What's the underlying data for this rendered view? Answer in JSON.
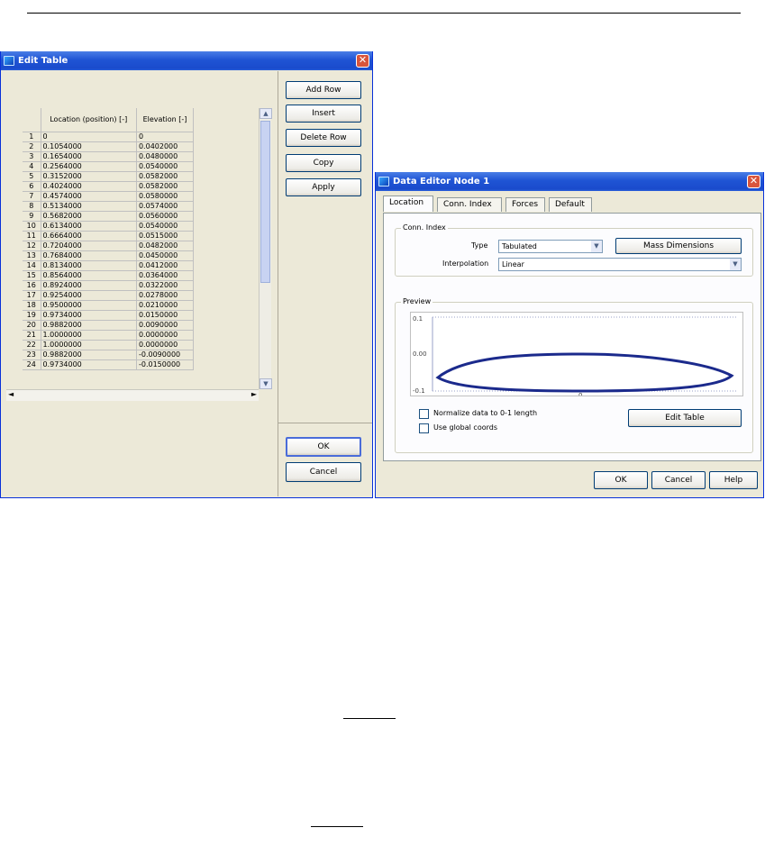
{
  "edit_table": {
    "title": "Edit Table",
    "buttons": {
      "add_row": "Add Row",
      "insert": "Insert",
      "delete_row": "Delete Row",
      "copy": "Copy",
      "apply": "Apply",
      "ok": "OK",
      "cancel": "Cancel"
    },
    "columns": [
      "Location (position) [-]",
      "Elevation [-]"
    ],
    "rows": [
      [
        "1",
        "0",
        "0"
      ],
      [
        "2",
        "0.1054000",
        "0.0402000"
      ],
      [
        "3",
        "0.1654000",
        "0.0480000"
      ],
      [
        "4",
        "0.2564000",
        "0.0540000"
      ],
      [
        "5",
        "0.3152000",
        "0.0582000"
      ],
      [
        "6",
        "0.4024000",
        "0.0582000"
      ],
      [
        "7",
        "0.4574000",
        "0.0580000"
      ],
      [
        "8",
        "0.5134000",
        "0.0574000"
      ],
      [
        "9",
        "0.5682000",
        "0.0560000"
      ],
      [
        "10",
        "0.6134000",
        "0.0540000"
      ],
      [
        "11",
        "0.6664000",
        "0.0515000"
      ],
      [
        "12",
        "0.7204000",
        "0.0482000"
      ],
      [
        "13",
        "0.7684000",
        "0.0450000"
      ],
      [
        "14",
        "0.8134000",
        "0.0412000"
      ],
      [
        "15",
        "0.8564000",
        "0.0364000"
      ],
      [
        "16",
        "0.8924000",
        "0.0322000"
      ],
      [
        "17",
        "0.9254000",
        "0.0278000"
      ],
      [
        "18",
        "0.9500000",
        "0.0210000"
      ],
      [
        "19",
        "0.9734000",
        "0.0150000"
      ],
      [
        "20",
        "0.9882000",
        "0.0090000"
      ],
      [
        "21",
        "1.0000000",
        "0.0000000"
      ],
      [
        "22",
        "1.0000000",
        "0.0000000"
      ],
      [
        "23",
        "0.9882000",
        "-0.0090000"
      ],
      [
        "24",
        "0.9734000",
        "-0.0150000"
      ]
    ]
  },
  "data_editor": {
    "title": "Data Editor Node 1",
    "tabs": [
      "Location",
      "Conn. Index",
      "Forces",
      "Default"
    ],
    "group_conn": "Conn. Index",
    "type_label": "Type",
    "type_value": "Tabulated",
    "mass_button": "Mass Dimensions",
    "interp_label": "Interpolation",
    "interp_value": "Linear",
    "group_preview": "Preview",
    "plot_ticks": {
      "y_top": "0.1",
      "y_mid": "0.00",
      "y_bottom": "-0.1",
      "x_mid": "0"
    },
    "edit_table_button": "Edit Table",
    "checkbox_1": "Normalize data to 0-1 length",
    "checkbox_2": "Use global coords",
    "buttons": {
      "ok": "OK",
      "cancel": "Cancel",
      "help": "Help"
    }
  }
}
